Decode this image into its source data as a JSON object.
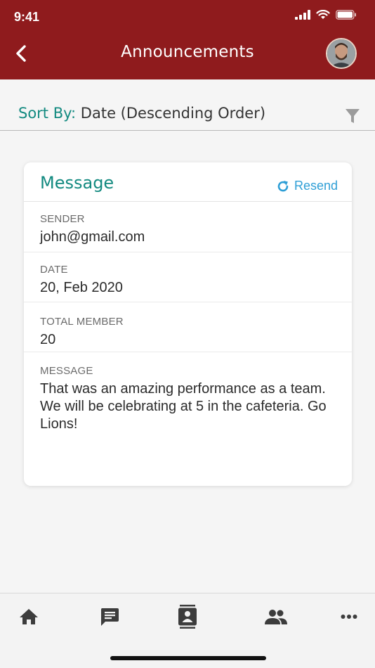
{
  "status_bar": {
    "time": "9:41"
  },
  "header": {
    "title": "Announcements"
  },
  "sort": {
    "label": "Sort By:",
    "value": "Date (Descending Order)"
  },
  "card": {
    "title": "Message",
    "resend_label": "Resend",
    "fields": [
      {
        "label": "SENDER",
        "value": "john@gmail.com"
      },
      {
        "label": "DATE",
        "value": "20, Feb 2020"
      },
      {
        "label": "TOTAL MEMBER",
        "value": "20"
      },
      {
        "label": "MESSAGE",
        "value": "That was an amazing performance as a team. We will be celebrating at 5 in the cafeteria. Go Lions!"
      }
    ]
  },
  "tabs": [
    {
      "icon": "home-icon"
    },
    {
      "icon": "message-icon"
    },
    {
      "icon": "contacts-icon"
    },
    {
      "icon": "group-icon"
    },
    {
      "icon": "more-icon"
    }
  ],
  "colors": {
    "header": "#8f1b1d",
    "accent_teal": "#138a80",
    "link_blue": "#2f9fd6",
    "background": "#f5f5f5"
  }
}
